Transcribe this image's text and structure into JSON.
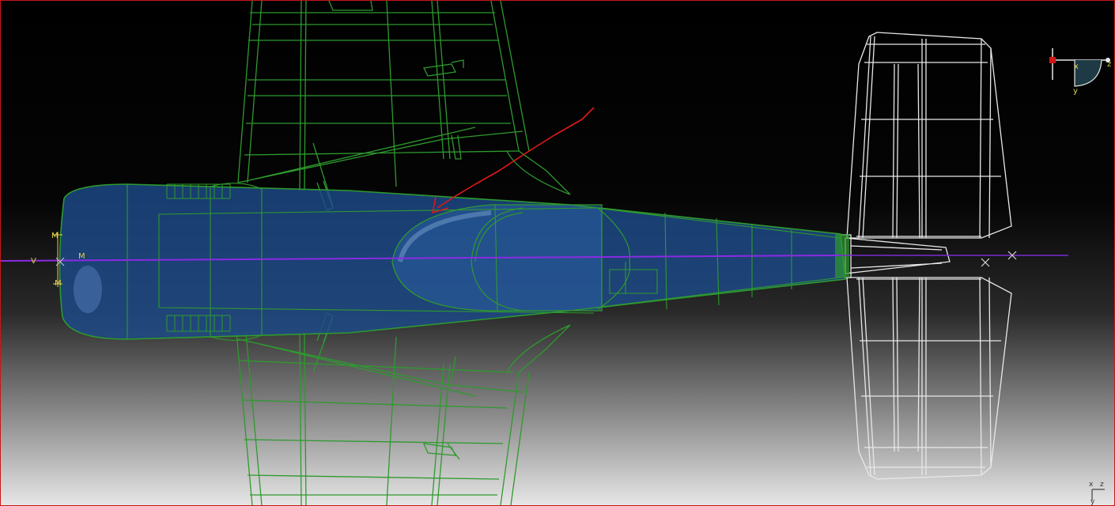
{
  "viewport": {
    "background_top": "#000000",
    "background_bottom": "#e6e6e6",
    "border_color": "#c81818"
  },
  "model": {
    "wing_wire_color": "#2e9a2e",
    "fuselage_fill": "#1d4a8a",
    "tail_wire_color": "#e8e8e8",
    "centerline_color": "#8a2be2",
    "annotation_color": "#e01818"
  },
  "origin_marker": {
    "labels": [
      "V",
      "M",
      "M",
      "M"
    ],
    "color": "#e0d24a"
  },
  "compass": {
    "x_label": "x",
    "y_label": "y",
    "z_label": "z",
    "origin_color": "#d01818"
  },
  "corner_triad": {
    "x_label": "x",
    "z_label": "z",
    "y_label": "y"
  }
}
